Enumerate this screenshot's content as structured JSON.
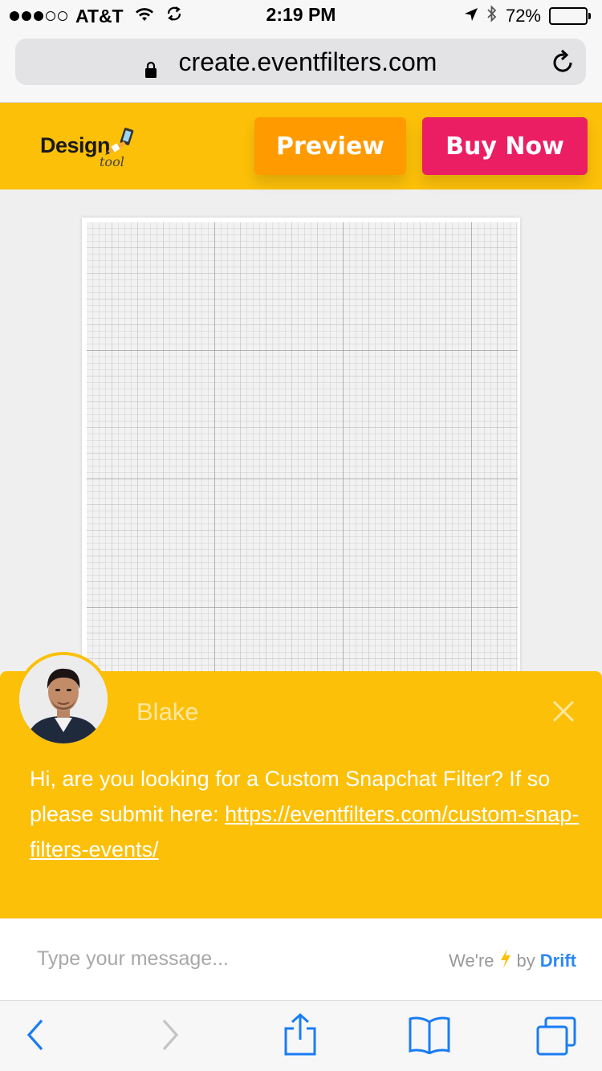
{
  "status_bar": {
    "carrier": "AT&T",
    "time": "2:19 PM",
    "battery_percent": "72%",
    "battery_level": 0.72,
    "signal_strength_of_5": 3
  },
  "browser": {
    "url": "create.eventfilters.com"
  },
  "header": {
    "logo_word": "Design",
    "logo_sub": "tool",
    "preview_label": "Preview",
    "buy_label": "Buy Now",
    "colors": {
      "bar": "#fcc009",
      "preview": "#ff9a00",
      "buy": "#ec1e63"
    }
  },
  "chat": {
    "agent_name": "Blake",
    "message": "Hi, are you looking for a Custom Snapchat Filter? If so please submit here:",
    "link": "https://eventfilters.com/custom-snap-filters-events/",
    "input_placeholder": "Type your message...",
    "brand_prefix": "We're",
    "brand_by": "by",
    "brand_name": "Drift",
    "icons": [
      "close-icon",
      "lightning-icon"
    ]
  },
  "toolbar": {
    "icons": [
      "back-icon",
      "forward-icon",
      "share-icon",
      "bookmarks-icon",
      "tabs-icon"
    ]
  }
}
